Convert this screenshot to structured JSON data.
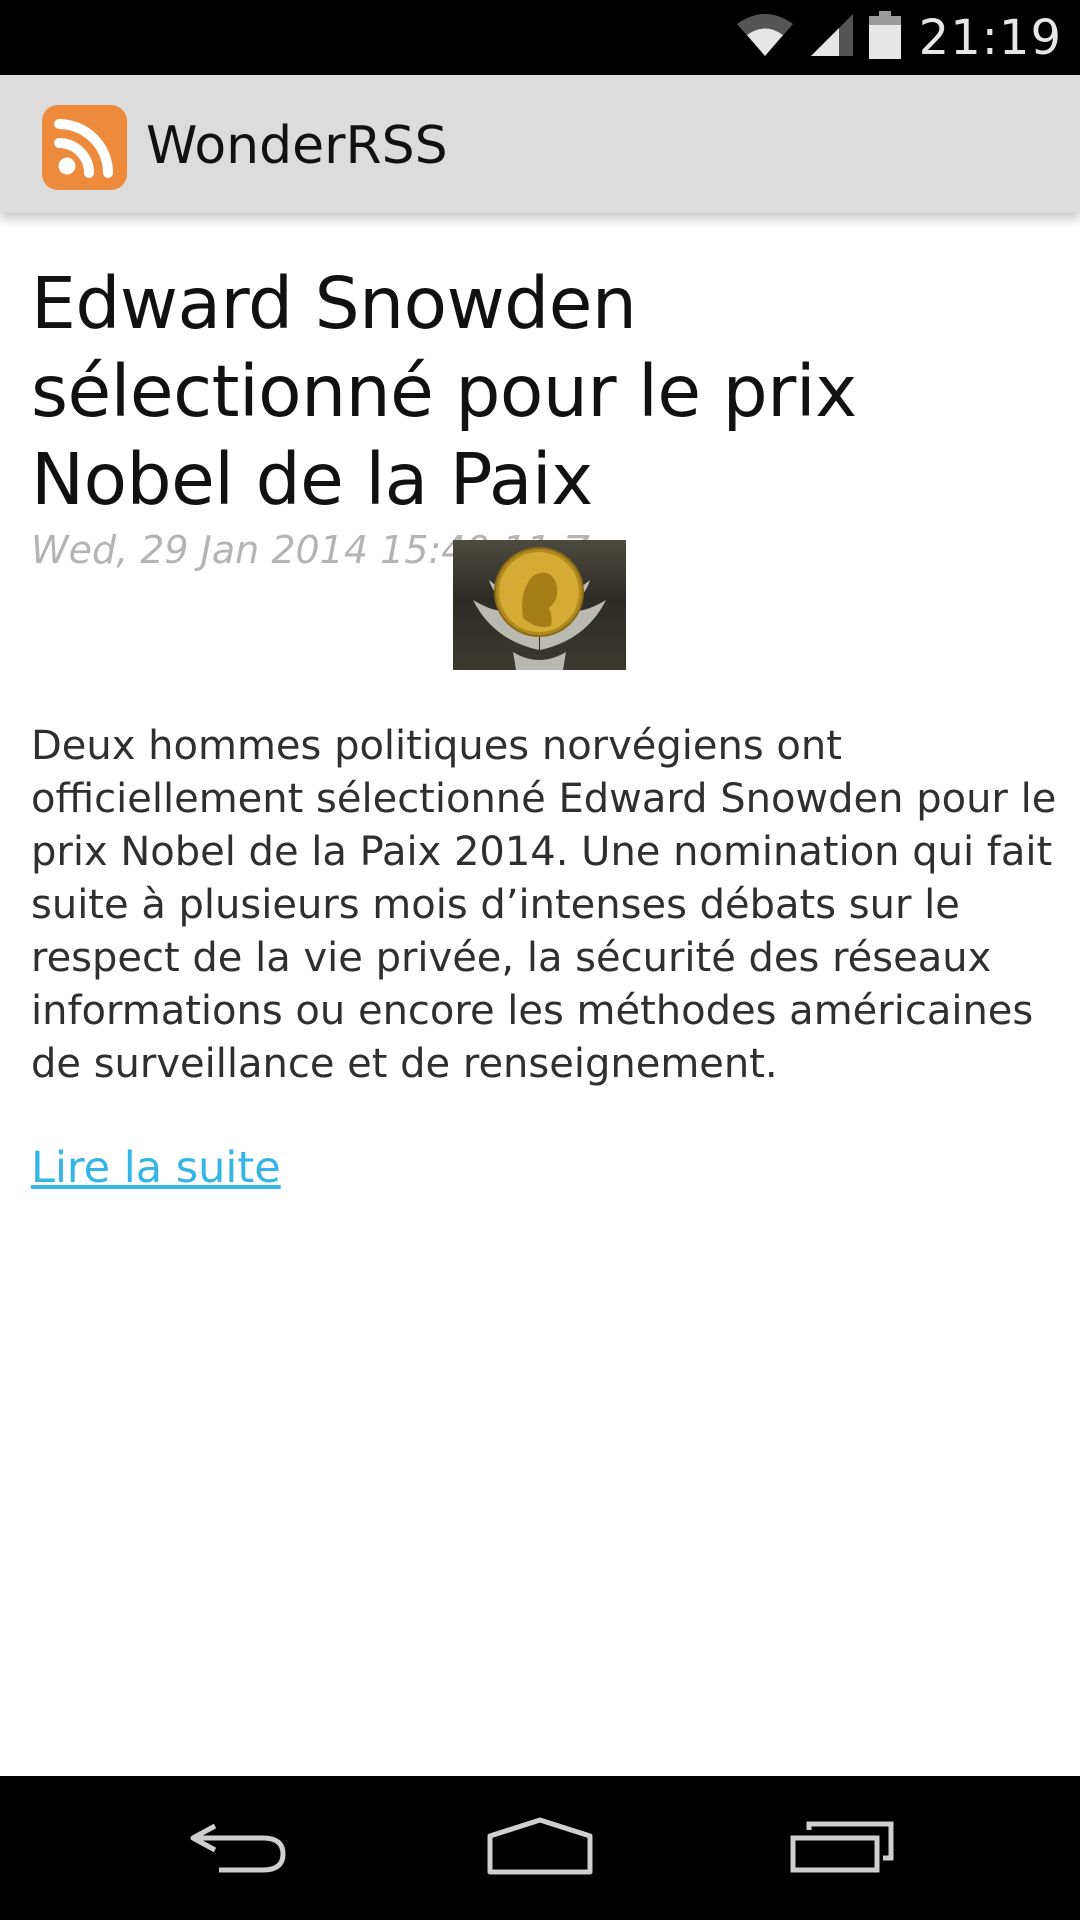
{
  "status_bar": {
    "time": "21:19",
    "icons": [
      "wifi-icon",
      "signal-icon",
      "battery-icon"
    ]
  },
  "action_bar": {
    "app_title": "WonderRSS",
    "app_icon": "rss-icon",
    "app_icon_color": "#ee8a3c"
  },
  "article": {
    "title": "Edward Snowden sélectionné pour le prix Nobel de la Paix",
    "date": "Wed, 29 Jan 2014 15:40:11 Z",
    "image": "nobel-medal-image",
    "body": "Deux hommes politiques norvégiens ont officiellement sélectionné Edward Snowden pour le prix Nobel de la Paix 2014. Une nomination qui fait suite à plusieurs mois d’intenses débats sur le respect de la vie privée, la sécurité des réseaux informations ou encore les méthodes américaines de surveillance et de renseignement.",
    "read_more": "Lire la suite",
    "link_color": "#33b5e5"
  },
  "nav_bar": {
    "buttons": [
      "back-icon",
      "home-icon",
      "recent-apps-icon"
    ]
  }
}
